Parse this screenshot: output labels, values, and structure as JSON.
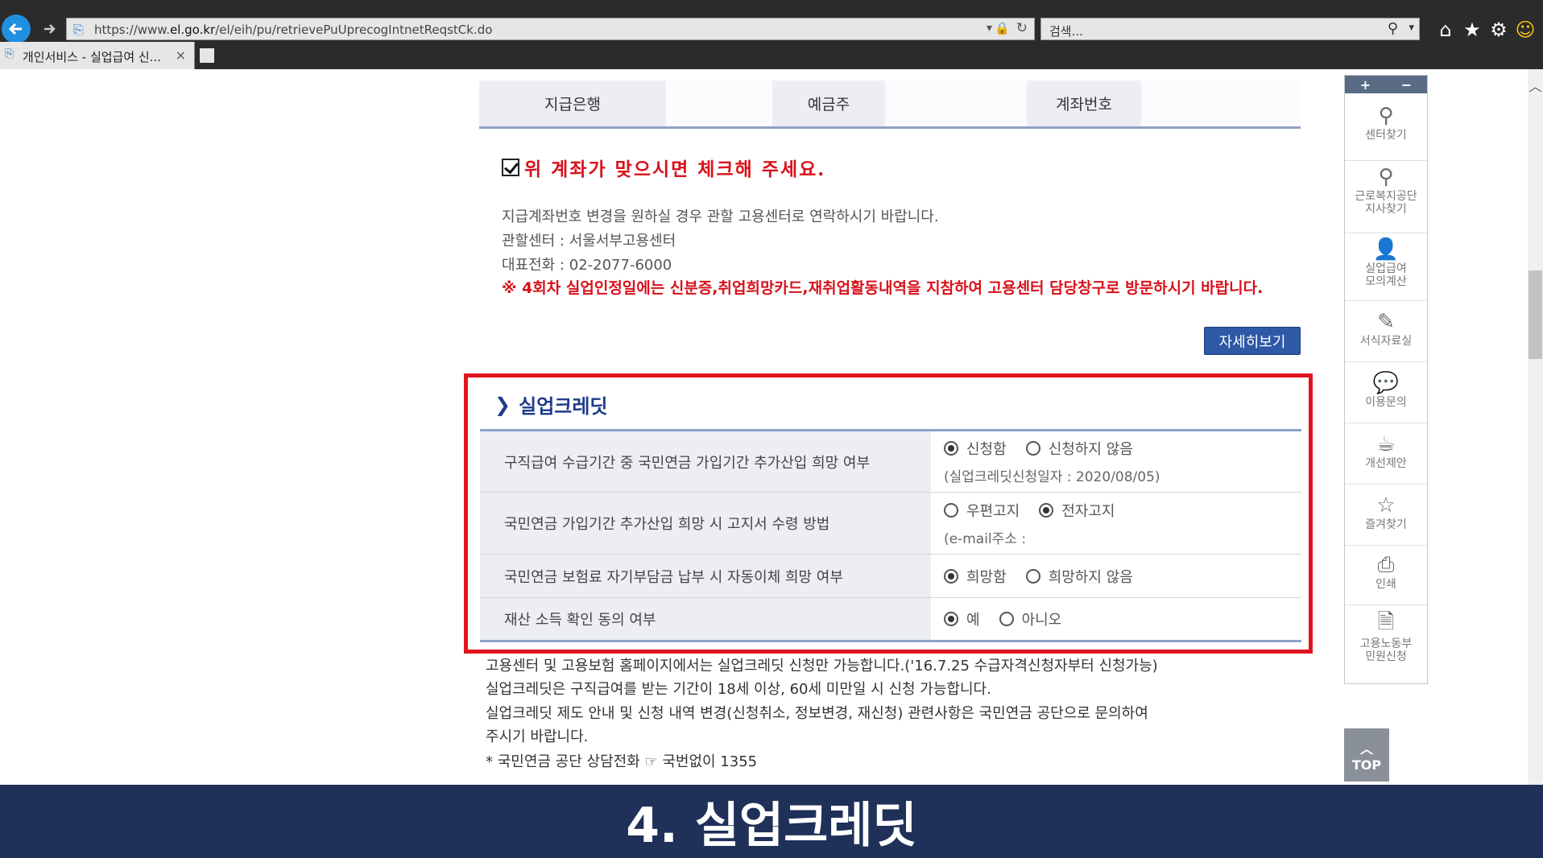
{
  "browser": {
    "url_prefix": "https://www.",
    "url_domain": "el.go.kr",
    "url_path": "/el/eih/pu/retrievePuUprecogIntnetReqstCk.do",
    "search_placeholder": "검색...",
    "tab_title": "개인서비스 - 실업급여 신...",
    "tab_close": "×"
  },
  "account_tabs": [
    "지급은행",
    "예금주",
    "계좌번호"
  ],
  "confirm": {
    "text": "위 계좌가 맞으시면 체크해 주세요."
  },
  "info": {
    "line1": "지급계좌번호 변경을 원하실 경우 관할 고용센터로 연락하시기 바랍니다.",
    "line2": "관할센터 : 서울서부고용센터",
    "line3": "대표전화 : 02-2077-6000",
    "notice": "※ 4회차 실업인정일에는 신분증,취업희망카드,재취업활동내역을 지참하여 고용센터 담당창구로 방문하시기 바랍니다."
  },
  "detail_button": "자세히보기",
  "credit": {
    "title": "실업크레딧",
    "rows": [
      {
        "label": "구직급여 수급기간 중 국민연금 가입기간 추가산입 희망 여부",
        "options": [
          "신청함",
          "신청하지 않음"
        ],
        "selected": 0,
        "sub": "(실업크레딧신청일자 : 2020/08/05)"
      },
      {
        "label": "국민연금 가입기간 추가산입 희망 시 고지서 수령 방법",
        "options": [
          "우편고지",
          "전자고지"
        ],
        "selected": 1,
        "sub": "(e-mail주소 :"
      },
      {
        "label": "국민연금 보험료 자기부담금 납부 시 자동이체 희망 여부",
        "options": [
          "희망함",
          "희망하지 않음"
        ],
        "selected": 0,
        "sub": ""
      },
      {
        "label": "재산 소득 확인 동의 여부",
        "options": [
          "예",
          "아니오"
        ],
        "selected": 0,
        "sub": ""
      }
    ]
  },
  "bottom": {
    "line1": "고용센터 및 고용보험 홈페이지에서는 실업크레딧 신청만 가능합니다.('16.7.25 수급자격신청자부터 신청가능)",
    "line2": "실업크레딧은 구직급여를 받는 기간이 18세 이상, 60세 미만일 시 신청 가능합니다.",
    "line3": "실업크레딧 제도 안내 및 신청 내역 변경(신청취소, 정보변경, 재신청) 관련사항은 국민연금 공단으로 문의하여",
    "line4": "주시기 바랍니다.",
    "line5": "* 국민연금 공단 상담전화 ☞ 국번없이 1355"
  },
  "quick_menu": {
    "plus": "+",
    "minus": "−",
    "items": [
      {
        "label": "센터찾기",
        "icon": "location-pin-icon"
      },
      {
        "label": "근로복지공단 지사찾기",
        "icon": "location-pin-icon"
      },
      {
        "label": "실업급여 모의계산",
        "icon": "person-icon"
      },
      {
        "label": "서식자료실",
        "icon": "edit-icon"
      },
      {
        "label": "이용문의",
        "icon": "chat-icon"
      },
      {
        "label": "개선제안",
        "icon": "coffee-icon"
      },
      {
        "label": "즐겨찾기",
        "icon": "star-icon"
      },
      {
        "label": "인쇄",
        "icon": "print-icon"
      },
      {
        "label": "고용노동부 민원신청",
        "icon": "document-icon"
      }
    ],
    "top_label": "TOP"
  },
  "caption": "4. 실업크레딧"
}
